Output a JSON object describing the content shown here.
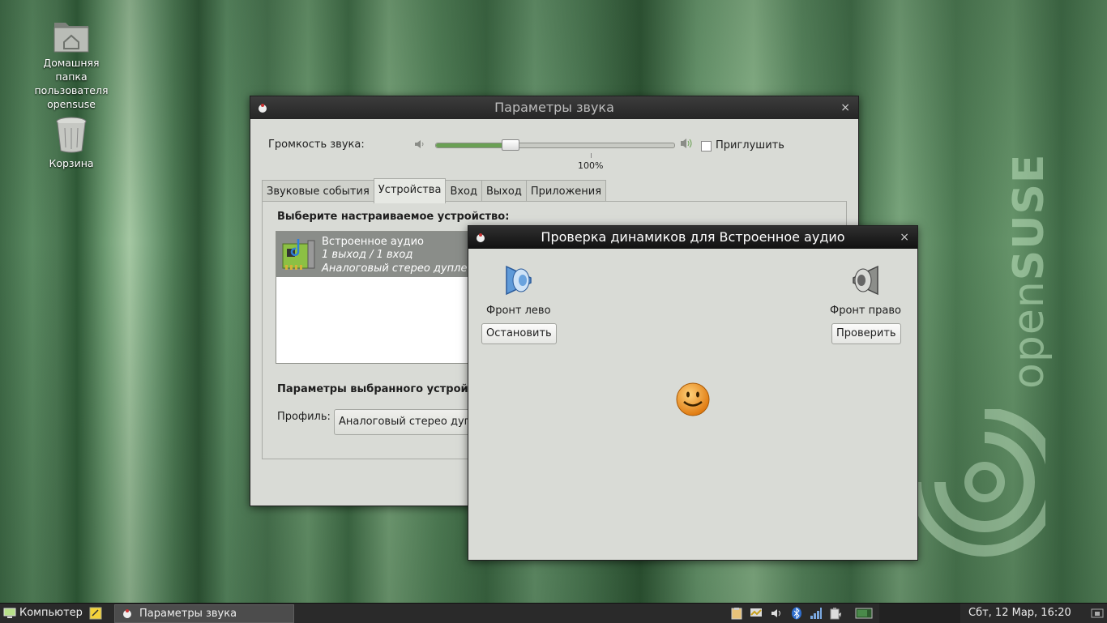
{
  "desktop": {
    "icons": [
      {
        "label_lines": [
          "Домашняя папка",
          "пользователя",
          "opensuse"
        ],
        "icon": "home-folder-icon"
      },
      {
        "label_lines": [
          "Корзина"
        ],
        "icon": "trash-icon"
      }
    ],
    "brand": {
      "open": "open",
      "suse": "SUSE"
    }
  },
  "main_window": {
    "title": "Параметры звука",
    "close": "×",
    "volume_label": "Громкость звука:",
    "volume_percent": 0.32,
    "volume_mark": "100%",
    "mute_label": "Приглушить",
    "mute_checked": false,
    "tabs": [
      {
        "label": "Звуковые события",
        "active": false
      },
      {
        "label": "Устройства",
        "active": true
      },
      {
        "label": "Вход",
        "active": false
      },
      {
        "label": "Выход",
        "active": false
      },
      {
        "label": "Приложения",
        "active": false
      }
    ],
    "choose_device_label": "Выберите настраиваемое устройство:",
    "device": {
      "name": "Встроенное аудио",
      "ports": "1 выход / 1 вход",
      "profile_desc": "Аналоговый стерео дуплекс"
    },
    "selected_params_label": "Параметры выбранного устройства",
    "profile_label": "Профиль:",
    "profile_value": "Аналоговый стерео дуплекс"
  },
  "test_window": {
    "title": "Проверка динамиков для Встроенное аудио",
    "close": "×",
    "left_speaker": {
      "label": "Фронт лево",
      "button": "Остановить",
      "active": true
    },
    "right_speaker": {
      "label": "Фронт право",
      "button": "Проверить",
      "active": false
    }
  },
  "taskbar": {
    "start_label": "Компьютер",
    "task_label": "Параметры звука",
    "clock": "Сбт, 12 Мар, 16:20"
  }
}
